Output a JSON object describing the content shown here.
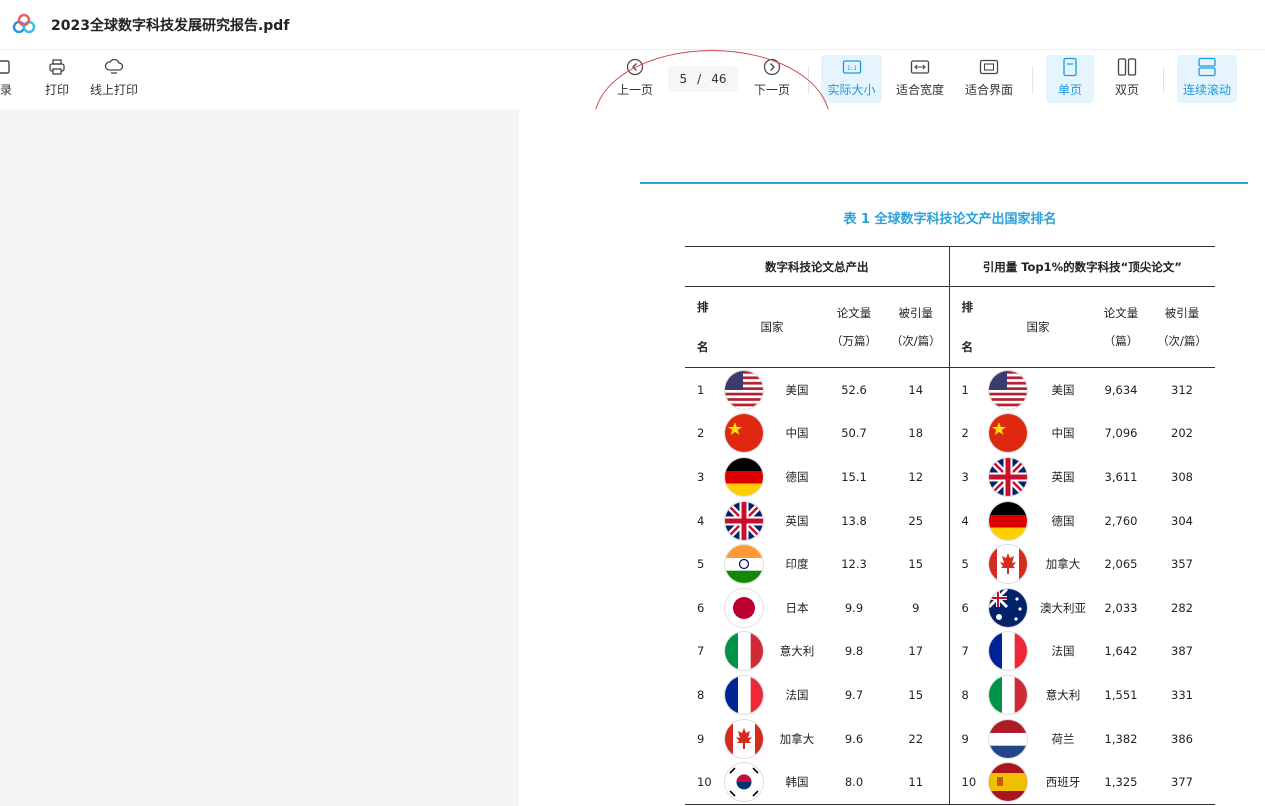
{
  "doc_title": "2023全球数字科技发展研究报告.pdf",
  "toolbar": {
    "left": [
      {
        "label": "录",
        "icon": "outline-icon"
      },
      {
        "label": "打印",
        "icon": "print-icon"
      },
      {
        "label": "线上打印",
        "icon": "cloud-print-icon"
      }
    ],
    "prev_label": "上一页",
    "next_label": "下一页",
    "current_page": "5",
    "page_sep": "/",
    "total_pages": "46",
    "views": [
      {
        "label": "实际大小",
        "icon": "actual-size-icon",
        "active": true
      },
      {
        "label": "适合宽度",
        "icon": "fit-width-icon",
        "active": false
      },
      {
        "label": "适合界面",
        "icon": "fit-page-icon",
        "active": false
      }
    ],
    "layouts": [
      {
        "label": "单页",
        "icon": "single-page-icon",
        "active": true
      },
      {
        "label": "双页",
        "icon": "double-page-icon",
        "active": false
      }
    ],
    "scroll": {
      "label": "连续滚动",
      "icon": "continuous-scroll-icon",
      "active": true
    },
    "accent": "#1a9ae0"
  },
  "table": {
    "title": "表 1 全球数字科技论文产出国家排名",
    "group_left": "数字科技论文总产出",
    "group_right": "引用量 Top1%的数字科技“顶尖论文”",
    "headers": {
      "rank_top": "排",
      "rank_bottom": "名",
      "country": "国家",
      "left_papers_1": "论文量",
      "left_papers_2": "（万篇）",
      "left_cites_1": "被引量",
      "left_cites_2": "（次/篇）",
      "right_papers_1": "论文量",
      "right_papers_2": "（篇）",
      "right_cites_1": "被引量",
      "right_cites_2": "（次/篇）"
    },
    "left_rows": [
      {
        "rank": "1",
        "flag": "us",
        "country": "美国",
        "papers": "52.6",
        "cites": "14"
      },
      {
        "rank": "2",
        "flag": "cn",
        "country": "中国",
        "papers": "50.7",
        "cites": "18"
      },
      {
        "rank": "3",
        "flag": "de",
        "country": "德国",
        "papers": "15.1",
        "cites": "12"
      },
      {
        "rank": "4",
        "flag": "gb",
        "country": "英国",
        "papers": "13.8",
        "cites": "25"
      },
      {
        "rank": "5",
        "flag": "in",
        "country": "印度",
        "papers": "12.3",
        "cites": "15"
      },
      {
        "rank": "6",
        "flag": "jp",
        "country": "日本",
        "papers": "9.9",
        "cites": "9"
      },
      {
        "rank": "7",
        "flag": "it",
        "country": "意大利",
        "papers": "9.8",
        "cites": "17"
      },
      {
        "rank": "8",
        "flag": "fr",
        "country": "法国",
        "papers": "9.7",
        "cites": "15"
      },
      {
        "rank": "9",
        "flag": "ca",
        "country": "加拿大",
        "papers": "9.6",
        "cites": "22"
      },
      {
        "rank": "10",
        "flag": "kr",
        "country": "韩国",
        "papers": "8.0",
        "cites": "11"
      }
    ],
    "right_rows": [
      {
        "rank": "1",
        "flag": "us",
        "country": "美国",
        "papers": "9,634",
        "cites": "312"
      },
      {
        "rank": "2",
        "flag": "cn",
        "country": "中国",
        "papers": "7,096",
        "cites": "202"
      },
      {
        "rank": "3",
        "flag": "gb",
        "country": "英国",
        "papers": "3,611",
        "cites": "308"
      },
      {
        "rank": "4",
        "flag": "de",
        "country": "德国",
        "papers": "2,760",
        "cites": "304"
      },
      {
        "rank": "5",
        "flag": "ca",
        "country": "加拿大",
        "papers": "2,065",
        "cites": "357"
      },
      {
        "rank": "6",
        "flag": "au",
        "country": "澳大利亚",
        "papers": "2,033",
        "cites": "282"
      },
      {
        "rank": "7",
        "flag": "fr",
        "country": "法国",
        "papers": "1,642",
        "cites": "387"
      },
      {
        "rank": "8",
        "flag": "it",
        "country": "意大利",
        "papers": "1,551",
        "cites": "331"
      },
      {
        "rank": "9",
        "flag": "nl",
        "country": "荷兰",
        "papers": "1,382",
        "cites": "386"
      },
      {
        "rank": "10",
        "flag": "es",
        "country": "西班牙",
        "papers": "1,325",
        "cites": "377"
      }
    ]
  }
}
